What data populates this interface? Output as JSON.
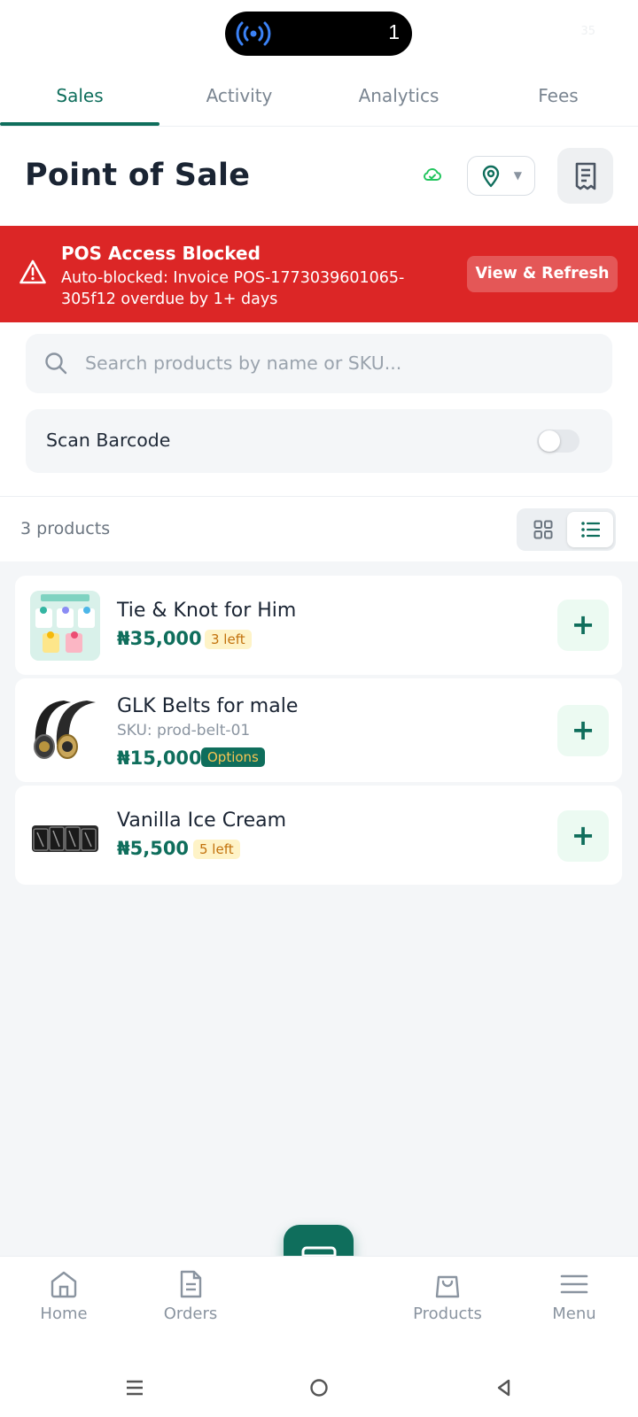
{
  "status_bar": {
    "notification_count": "1",
    "right_text": "35"
  },
  "tabs": [
    {
      "label": "Sales",
      "active": true
    },
    {
      "label": "Activity",
      "active": false
    },
    {
      "label": "Analytics",
      "active": false
    },
    {
      "label": "Fees",
      "active": false
    }
  ],
  "header": {
    "title": "Point of Sale",
    "sync_icon": "cloud-sync-icon",
    "location_icon": "map-pin-icon",
    "receipt_icon": "receipt-icon"
  },
  "alert": {
    "title": "POS Access Blocked",
    "message": "Auto-blocked: Invoice POS-1773039601065-305f12 overdue by 1+ days",
    "button_label": "View & Refresh",
    "color": "#dc2626"
  },
  "search": {
    "placeholder": "Search products by name or SKU..."
  },
  "scan": {
    "label": "Scan Barcode",
    "enabled": false
  },
  "list_header": {
    "count_text": "3 products",
    "view_mode": "list"
  },
  "products": [
    {
      "name": "Tie & Knot for Him",
      "sku": "",
      "price": "₦35,000",
      "badge": "3 left",
      "badge_type": "stock"
    },
    {
      "name": "GLK Belts for male",
      "sku": "SKU: prod-belt-01",
      "price": "₦15,000",
      "badge": "Options",
      "badge_type": "options"
    },
    {
      "name": "Vanilla Ice Cream",
      "sku": "",
      "price": "₦5,500",
      "badge": "5 left",
      "badge_type": "stock"
    }
  ],
  "bottom_nav": [
    {
      "label": "Home",
      "icon": "home-icon"
    },
    {
      "label": "Orders",
      "icon": "document-icon"
    },
    {
      "label": "Products",
      "icon": "shopping-bag-icon"
    },
    {
      "label": "Menu",
      "icon": "hamburger-menu-icon"
    }
  ],
  "colors": {
    "brand": "#0f6e5c",
    "alert": "#dc2626",
    "background": "#f4f6f8"
  }
}
